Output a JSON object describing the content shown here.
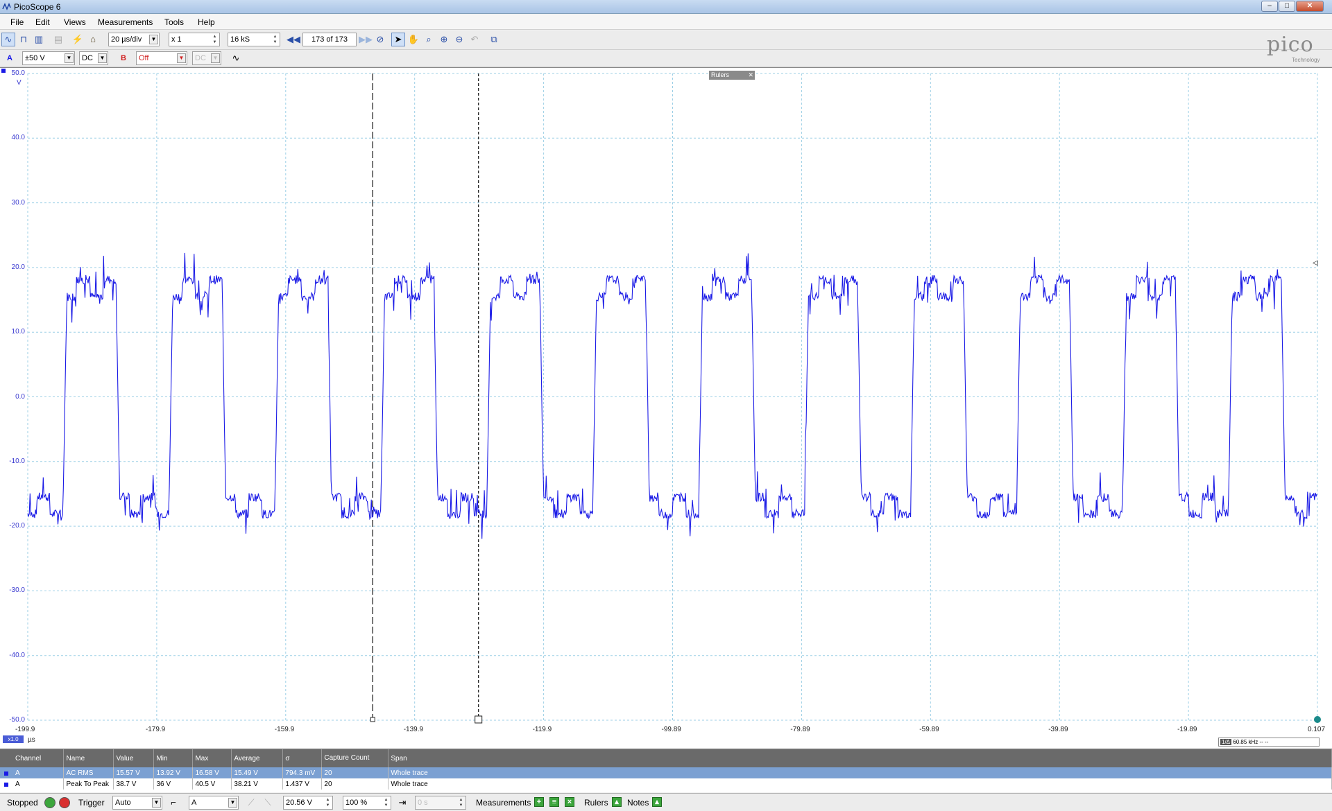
{
  "window": {
    "title": "PicoScope 6",
    "controls": [
      "–",
      "□",
      "✕"
    ]
  },
  "menu": {
    "items": [
      "File",
      "Edit",
      "Views",
      "Measurements",
      "Tools",
      "Help"
    ]
  },
  "toolbar1": {
    "timebase": "20 µs/div",
    "zoom": "x 1",
    "samples": "16 kS",
    "buffer": "173 of 173"
  },
  "toolbar2": {
    "channel_a": "A",
    "range_a": "±50 V",
    "coupling_a": "DC",
    "channel_b": "B",
    "range_b": "Off",
    "coupling_b": "DC"
  },
  "logo": {
    "name": "pico",
    "sub": "Technology"
  },
  "scope": {
    "rulers_tag": "Rulers",
    "y_unit": "V",
    "x_unit": "µs",
    "x_scale": "x1.0",
    "y_ticks": [
      "50.0",
      "40.0",
      "30.0",
      "20.0",
      "10.0",
      "0.0",
      "-10.0",
      "-20.0",
      "-30.0",
      "-40.0",
      "-50.0"
    ],
    "x_ticks": [
      "-199.9",
      "-179.9",
      "-159.9",
      "-139.9",
      "-119.9",
      "-99.89",
      "-79.89",
      "-59.89",
      "-39.89",
      "-19.89",
      "0.107"
    ],
    "ruler_readout": "60.85 kHz  -- --",
    "ruler_readout_tag": "1/Δ",
    "trace_color": "#1a1ae6",
    "grid_color": "#9ccfe6"
  },
  "chart_data": {
    "type": "line",
    "xlabel": "µs",
    "ylabel": "V",
    "xlim": [
      -199.9,
      0.107
    ],
    "ylim": [
      -50.0,
      50.0
    ],
    "grid": true,
    "series": [
      {
        "name": "A",
        "description_values": {
          "waveform": "square",
          "high_level_approx": 16.5,
          "low_level_approx": -16.5,
          "period_us_approx": 16.43,
          "first_rising_edge_us": -194.4
        }
      }
    ],
    "rulers_us": [
      -146.4,
      -130.0
    ]
  },
  "measurements": {
    "headers": [
      "Channel",
      "Name",
      "Value",
      "Min",
      "Max",
      "Average",
      "σ",
      "Capture Count",
      "Span"
    ],
    "rows": [
      [
        "A",
        "AC RMS",
        "15.57 V",
        "13.92 V",
        "16.58 V",
        "15.49 V",
        "794.3 mV",
        "20",
        "Whole trace"
      ],
      [
        "A",
        "Peak To Peak",
        "38.7 V",
        "36 V",
        "40.5 V",
        "38.21 V",
        "1.437 V",
        "20",
        "Whole trace"
      ]
    ]
  },
  "status": {
    "state": "Stopped",
    "trigger_label": "Trigger",
    "trigger_mode": "Auto",
    "trigger_channel": "A",
    "trigger_level": "20.56 V",
    "pretrigger": "100 %",
    "delay": "0 s",
    "measurements_label": "Measurements",
    "rulers_label": "Rulers",
    "notes_label": "Notes"
  }
}
